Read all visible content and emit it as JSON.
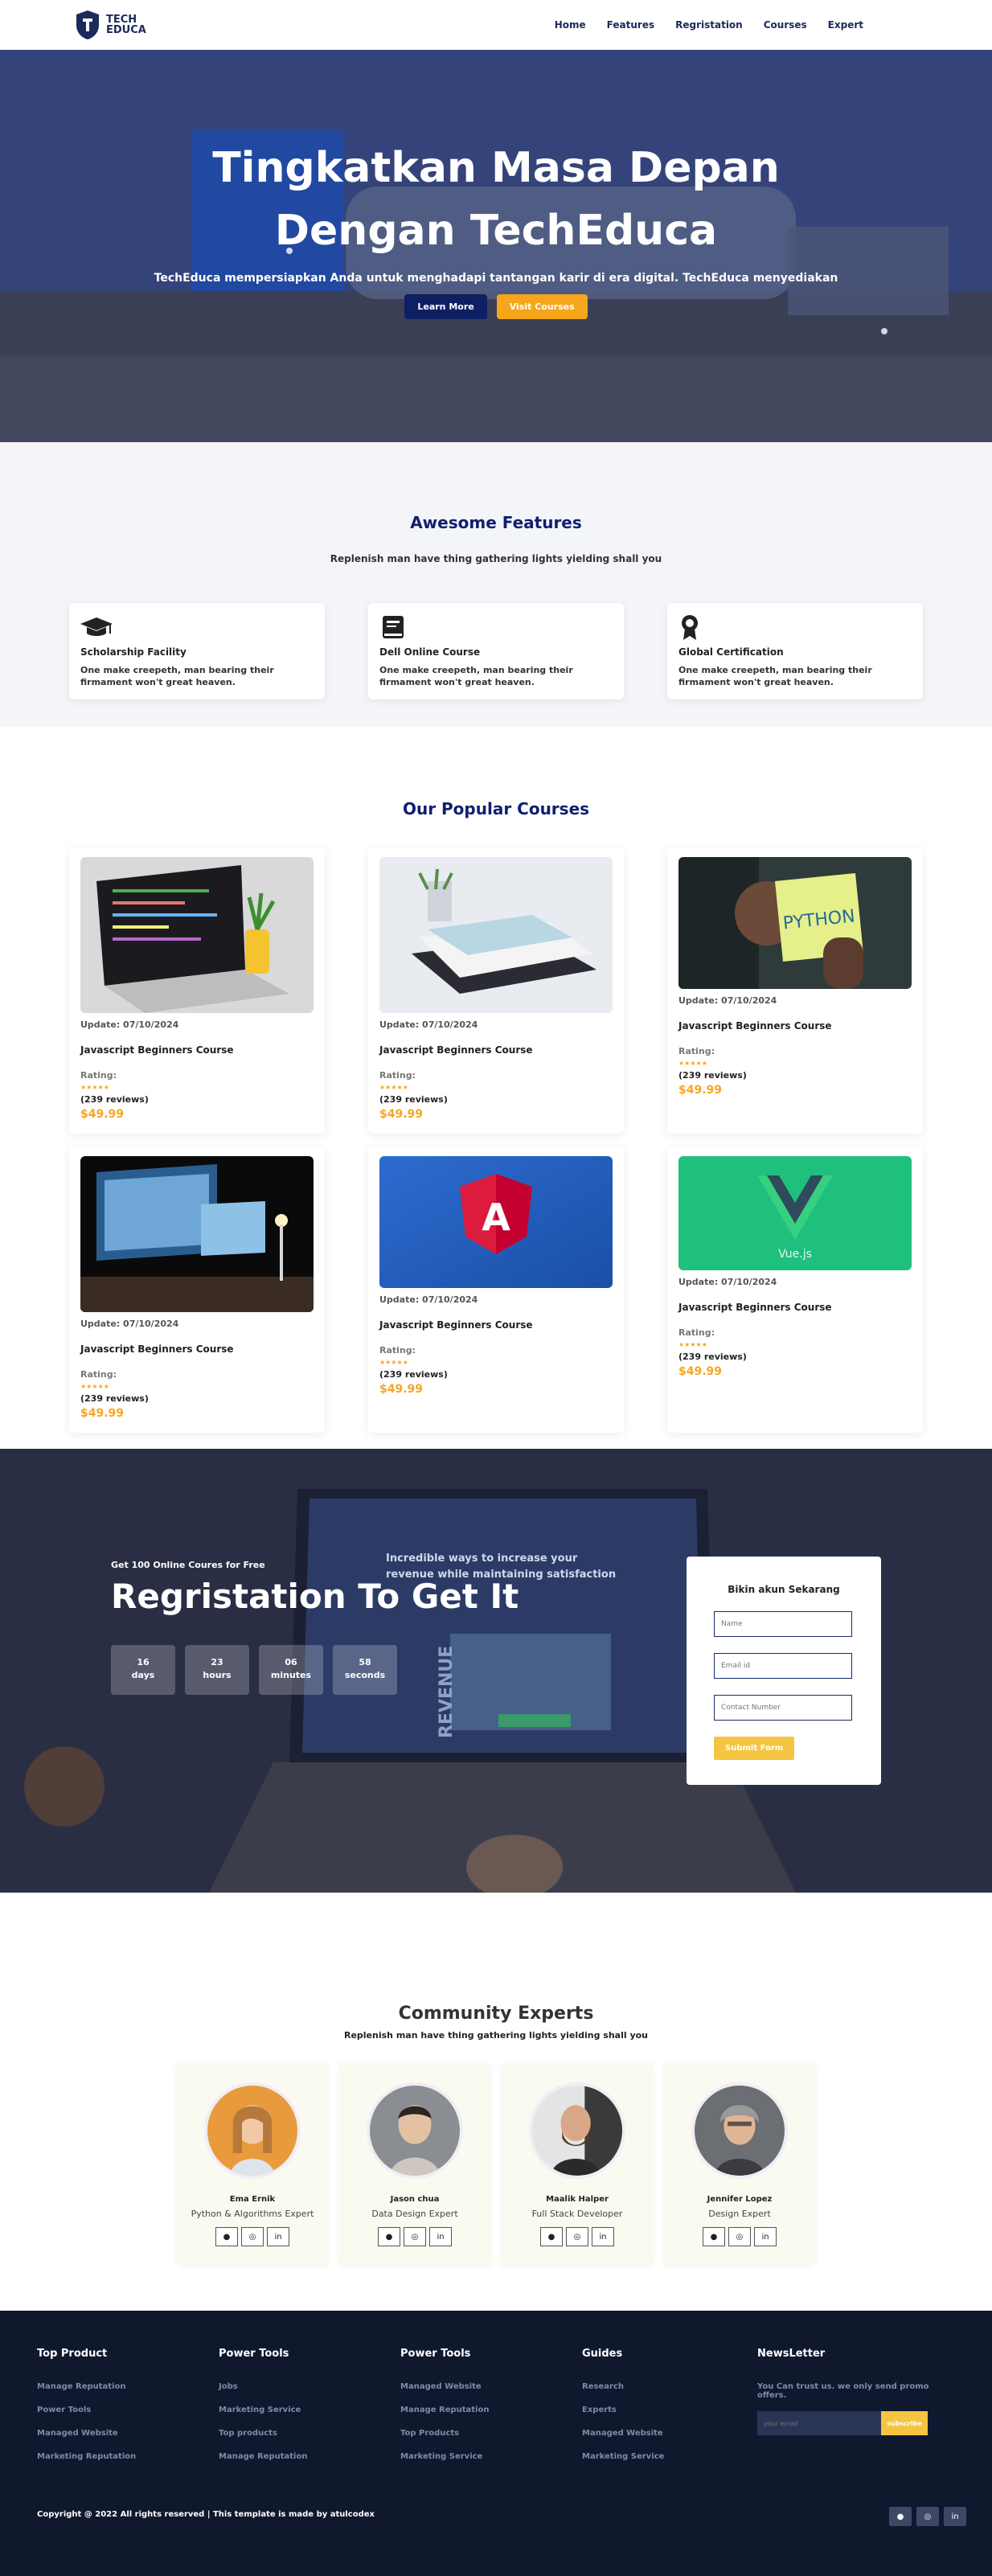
{
  "nav": {
    "logo_line1": "TECH",
    "logo_line2": "EDUCA",
    "links": [
      "Home",
      "Features",
      "Regristation",
      "Courses",
      "Expert"
    ]
  },
  "hero": {
    "title": "Tingkatkan Masa Depan Dengan TechEduca",
    "subtitle": "TechEduca mempersiapkan Anda untuk menghadapi tantangan karir di era digital. TechEduca menyediakan",
    "btn_primary": "Learn More",
    "btn_secondary": "Visit Courses"
  },
  "features": {
    "title": "Awesome Features",
    "subtitle": "Replenish man have thing gathering lights yielding shall you",
    "items": [
      {
        "icon": "graduation-cap-icon",
        "name": "Scholarship Facility",
        "desc": "One make creepeth, man bearing their firmament won't great heaven."
      },
      {
        "icon": "book-icon",
        "name": "Dell Online Course",
        "desc": "One make creepeth, man bearing their firmament won't great heaven."
      },
      {
        "icon": "certificate-icon",
        "name": "Global Certification",
        "desc": "One make creepeth, man bearing their firmament won't great heaven."
      }
    ]
  },
  "courses": {
    "title": "Our Popular Courses",
    "items": [
      {
        "image": "laptop-code-image",
        "update": "Update: 07/10/2024",
        "name": "Javascript Beginners Course",
        "rating_label": "Rating:",
        "stars": "★★★★★",
        "reviews": "(239 reviews)",
        "price": "$49.99"
      },
      {
        "image": "books-image",
        "update": "Update: 07/10/2024",
        "name": "Javascript Beginners Course",
        "rating_label": "Rating:",
        "stars": "★★★★★",
        "reviews": "(239 reviews)",
        "price": "$49.99"
      },
      {
        "image": "python-note-image",
        "update": "Update: 07/10/2024",
        "name": "Javascript Beginners Course",
        "rating_label": "Rating:",
        "stars": "★★★★★",
        "reviews": "(239 reviews)",
        "price": "$49.99",
        "image_text": "PYTHON"
      },
      {
        "image": "desk-monitor-image",
        "update": "Update: 07/10/2024",
        "name": "Javascript Beginners Course",
        "rating_label": "Rating:",
        "stars": "★★★★★",
        "reviews": "(239 reviews)",
        "price": "$49.99"
      },
      {
        "image": "angular-logo-image",
        "update": "Update: 07/10/2024",
        "name": "Javascript Beginners Course",
        "rating_label": "Rating:",
        "stars": "★★★★★",
        "reviews": "(239 reviews)",
        "price": "$49.99",
        "image_text": "A"
      },
      {
        "image": "vue-logo-image",
        "update": "Update: 07/10/2024",
        "name": "Javascript Beginners Course",
        "rating_label": "Rating:",
        "stars": "★★★★★",
        "reviews": "(239 reviews)",
        "price": "$49.99",
        "image_text": "Vue.js"
      }
    ]
  },
  "registration": {
    "small": "Get 100 Online Coures for Free",
    "title": "Regristation To Get It",
    "counters": [
      {
        "value": "16",
        "unit": "days"
      },
      {
        "value": "23",
        "unit": "hours"
      },
      {
        "value": "06",
        "unit": "minutes"
      },
      {
        "value": "58",
        "unit": "seconds"
      }
    ],
    "form": {
      "title": "Bikin akun Sekarang",
      "name_placeholder": "Name",
      "email_placeholder": "Email id",
      "phone_placeholder": "Contact Number",
      "submit": "Submit Form"
    },
    "screen_text_1": "Incredible ways to increase your",
    "screen_text_2": "revenue while maintaining satisfaction",
    "screen_text_3": "REVENUE"
  },
  "experts": {
    "title": "Community Experts",
    "subtitle": "Replenish man have thing gathering lights yielding shall you",
    "items": [
      {
        "name": "Ema Ernik",
        "role": "Python & Algorithms Expert"
      },
      {
        "name": "Jason chua",
        "role": "Data Design Expert"
      },
      {
        "name": "Maalik Halper",
        "role": "Full Stack Developer"
      },
      {
        "name": "Jennifer Lopez",
        "role": "Design Expert"
      }
    ]
  },
  "footer": {
    "columns": [
      {
        "title": "Top Product",
        "links": [
          "Manage Reputation",
          "Power Tools",
          "Managed Website",
          "Marketing Reputation"
        ]
      },
      {
        "title": "Power Tools",
        "links": [
          "Jobs",
          "Marketing Service",
          "Top products",
          "Manage Reputation"
        ]
      },
      {
        "title": "Power Tools",
        "links": [
          "Managed Website",
          "Manage Reputation",
          "Top Products",
          "Marketing Service"
        ]
      },
      {
        "title": "Guides",
        "links": [
          "Research",
          "Experts",
          "Managed Website",
          "Marketing Service"
        ]
      }
    ],
    "newsletter": {
      "title": "NewsLetter",
      "text": "You Can trust us. we only send promo offers.",
      "placeholder": "your email",
      "button": "subscribe"
    },
    "copyright": "Copyright @ 2022 All rights reserved | This template is made by atulcodex"
  },
  "colors": {
    "navy": "#0f1f6e",
    "orange": "#f5a623",
    "footer": "#10182e"
  }
}
